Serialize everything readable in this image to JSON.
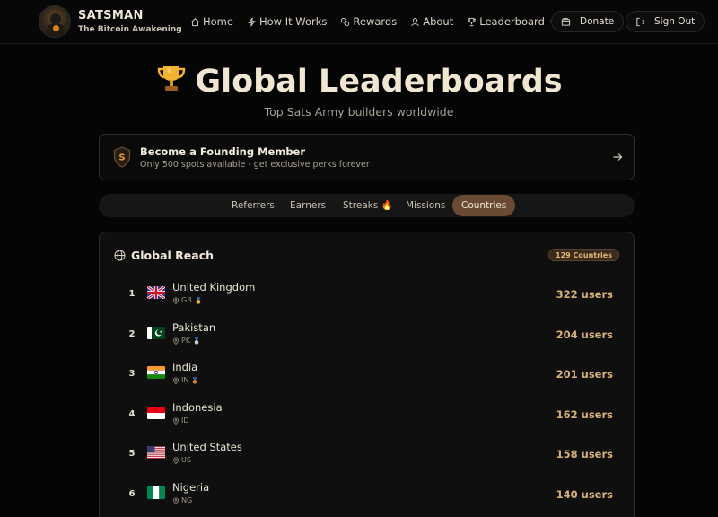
{
  "brand": {
    "name": "SATSMAN",
    "tagline": "The Bitcoin Awakening"
  },
  "nav": {
    "items": [
      {
        "label": "Home",
        "icon": "home-icon"
      },
      {
        "label": "How It Works",
        "icon": "zap-icon"
      },
      {
        "label": "Rewards",
        "icon": "gift-icon"
      },
      {
        "label": "About",
        "icon": "user-icon"
      },
      {
        "label": "Leaderboard",
        "icon": "trophy-icon",
        "dropdown": true
      }
    ],
    "donate_label": "Donate",
    "signout_label": "Sign Out"
  },
  "hero": {
    "title": "Global Leaderboards",
    "subtitle": "Top Sats Army builders worldwide"
  },
  "founder": {
    "badge_letter": "S",
    "title": "Become a Founding Member",
    "subtitle": "Only 500 spots available - get exclusive perks forever"
  },
  "tabs": [
    {
      "label": "Referrers",
      "active": false
    },
    {
      "label": "Earners",
      "active": false
    },
    {
      "label": "Streaks 🔥",
      "active": false
    },
    {
      "label": "Missions",
      "active": false
    },
    {
      "label": "Countries",
      "active": true
    }
  ],
  "panel": {
    "title": "Global Reach",
    "count_badge": "129 Countries",
    "rows": [
      {
        "rank": "1",
        "name": "United Kingdom",
        "code": "GB",
        "medal": "gold",
        "users": "322 users"
      },
      {
        "rank": "2",
        "name": "Pakistan",
        "code": "PK",
        "medal": "silver",
        "users": "204 users"
      },
      {
        "rank": "3",
        "name": "India",
        "code": "IN",
        "medal": "bronze",
        "users": "201 users"
      },
      {
        "rank": "4",
        "name": "Indonesia",
        "code": "ID",
        "medal": "",
        "users": "162 users"
      },
      {
        "rank": "5",
        "name": "United States",
        "code": "US",
        "medal": "",
        "users": "158 users"
      },
      {
        "rank": "6",
        "name": "Nigeria",
        "code": "NG",
        "medal": "",
        "users": "140 users"
      }
    ]
  },
  "colors": {
    "accent": "#d7b27a",
    "active_tab": "#6b4a33",
    "background": "#050505"
  }
}
